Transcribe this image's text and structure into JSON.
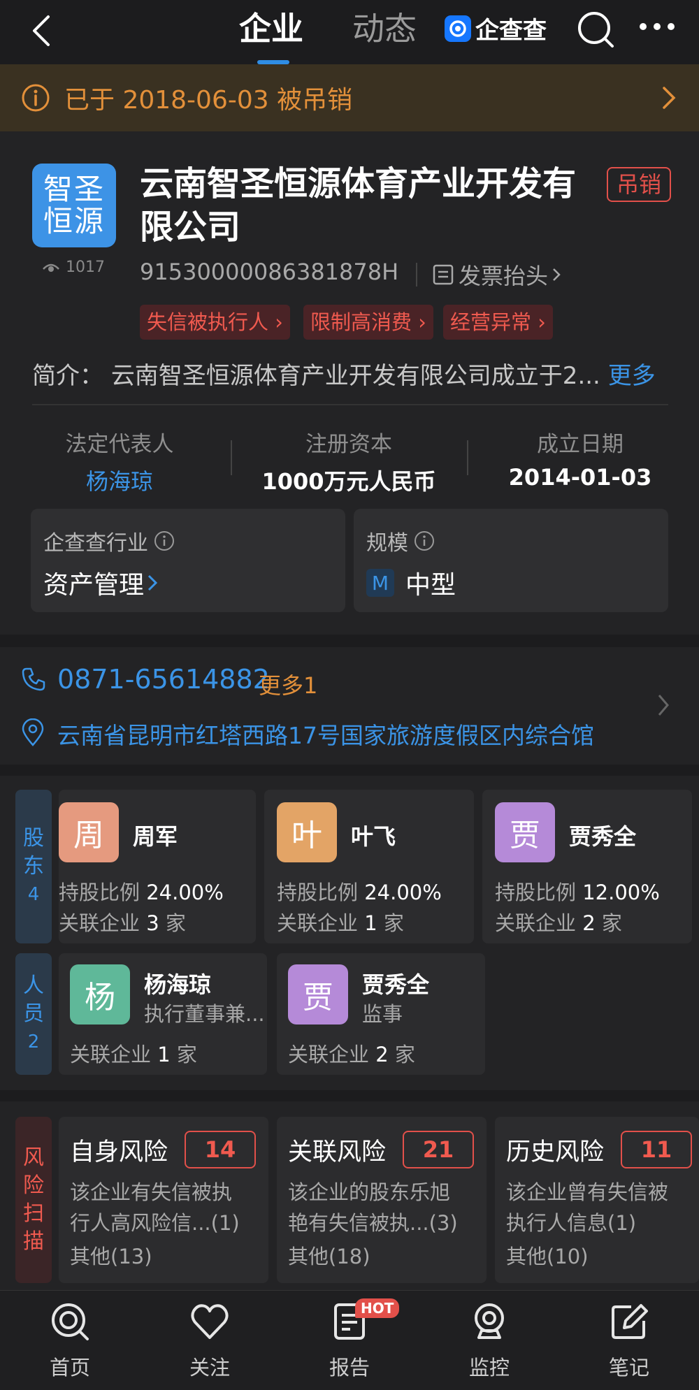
{
  "header": {
    "tab_company": "企业",
    "tab_dynamic": "动态",
    "brand": "企查查"
  },
  "banner": {
    "text": "已于 2018-06-03 被吊销"
  },
  "company": {
    "logo_text": "智圣恒源",
    "name": "云南智圣恒源体育产业开发有限公司",
    "status_badge": "吊销",
    "views": "1017",
    "credit_code": "91530000086381878H",
    "invoice_label": "发票抬头",
    "tags": [
      "失信被执行人",
      "限制高消费",
      "经营异常"
    ],
    "intro_prefix": "简介：",
    "intro_text": "云南智圣恒源体育产业开发有限公司成立于2...",
    "intro_more": "更多",
    "legal_rep_label": "法定代表人",
    "legal_rep_value": "杨海琼",
    "capital_label": "注册资本",
    "capital_value": "1000万元人民币",
    "founded_label": "成立日期",
    "founded_value": "2014-01-03",
    "industry_label": "企查查行业",
    "industry_value": "资产管理",
    "scale_label": "规模",
    "scale_badge": "M",
    "scale_value": "中型"
  },
  "contact": {
    "phone": "0871-65614882",
    "phone_more": "更多1",
    "address": "云南省昆明市红塔西路17号国家旅游度假区内综合馆"
  },
  "shareholders": {
    "label_lines": [
      "股",
      "东",
      "4"
    ],
    "items": [
      {
        "avatar": "周",
        "name": "周军",
        "ratio_label": "持股比例",
        "ratio": "24.00%",
        "related_label": "关联企业",
        "related": "3",
        "unit": "家",
        "color": "#e59a7f"
      },
      {
        "avatar": "叶",
        "name": "叶飞",
        "ratio_label": "持股比例",
        "ratio": "24.00%",
        "related_label": "关联企业",
        "related": "1",
        "unit": "家",
        "color": "#e3a466"
      },
      {
        "avatar": "贾",
        "name": "贾秀全",
        "ratio_label": "持股比例",
        "ratio": "12.00%",
        "related_label": "关联企业",
        "related": "2",
        "unit": "家",
        "color": "#b58ad8"
      }
    ]
  },
  "staff": {
    "label_lines": [
      "人",
      "员",
      "2"
    ],
    "items": [
      {
        "avatar": "杨",
        "name": "杨海琼",
        "role": "执行董事兼...",
        "related_label": "关联企业",
        "related": "1",
        "unit": "家",
        "color": "#5fb899"
      },
      {
        "avatar": "贾",
        "name": "贾秀全",
        "role": "监事",
        "related_label": "关联企业",
        "related": "2",
        "unit": "家",
        "color": "#b58ad8"
      }
    ]
  },
  "risk": {
    "label_lines": [
      "风",
      "险",
      "扫",
      "描"
    ],
    "items": [
      {
        "title": "自身风险",
        "count": "14",
        "desc1": "该企业有失信被执",
        "desc2": "行人高风险信...(1)",
        "other": "其他(13)"
      },
      {
        "title": "关联风险",
        "count": "21",
        "desc1": "该企业的股东乐旭",
        "desc2": "艳有失信被执...(3)",
        "other": "其他(18)"
      },
      {
        "title": "历史风险",
        "count": "11",
        "desc1": "该企业曾有失信被",
        "desc2": "执行人信息(1)",
        "other": "其他(10)"
      }
    ]
  },
  "tabbar": {
    "home": "首页",
    "follow": "关注",
    "report": "报告",
    "monitor": "监控",
    "notes": "笔记",
    "hot": "HOT"
  }
}
